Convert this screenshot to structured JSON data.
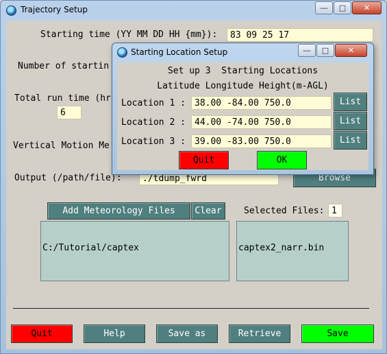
{
  "main": {
    "title": "Trajectory Setup",
    "starting_time_label": "Starting time (YY MM DD HH {mm}):",
    "starting_time_value": "83 09 25 17",
    "num_starting_label": "Number of startin",
    "total_run_label": "Total run time (hr",
    "total_run_value": "6",
    "vertical_motion_label": "Vertical Motion Me",
    "output_label": "Output (/path/file):",
    "output_value": "./tdump_fwrd",
    "browse_label": "Browse",
    "add_met_label": "Add Meteorology Files",
    "clear_label": "Clear",
    "selected_files_label": "Selected Files:",
    "selected_files_count": "1",
    "met_dir_item": "C:/Tutorial/captex",
    "selected_file_item": "captex2_narr.bin",
    "buttons": {
      "quit": "Quit",
      "help": "Help",
      "save_as": "Save as",
      "retrieve": "Retrieve",
      "save": "Save"
    }
  },
  "popup": {
    "title": "Starting Location Setup",
    "header1": "Set up 3  Starting Locations",
    "header2": "Latitude Longitude Height(m-AGL)",
    "locations": [
      {
        "label": "Location 1 :",
        "value": "38.00 -84.00 750.0",
        "list": "List"
      },
      {
        "label": "Location 2 :",
        "value": "44.00 -74.00 750.0",
        "list": "List"
      },
      {
        "label": "Location 3 :",
        "value": "39.00 -83.00 750.0",
        "list": "List"
      }
    ],
    "quit": "Quit",
    "ok": "OK"
  },
  "colors": {
    "accent": "#4f7f7e",
    "quit": "#ff0000",
    "save": "#00ff00",
    "entry": "#fffdd8",
    "listbox": "#b7cfcb"
  }
}
